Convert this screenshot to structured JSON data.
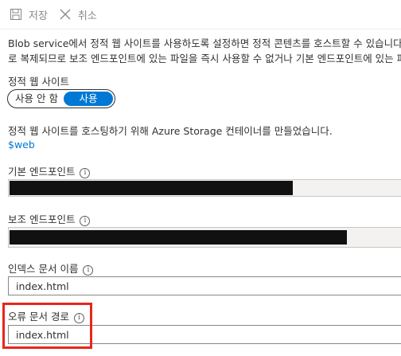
{
  "toolbar": {
    "save_label": "저장",
    "cancel_label": "취소"
  },
  "description": {
    "line1": "Blob service에서 정적 웹 사이트를 사용하도록 설정하면 정적 콘텐츠를 호스트할 수 있습니다. 웹",
    "line2": "로 복제되므로 보조 엔드포인트에 있는 파일을 즉시 사용할 수 없거나 기본 엔드포인트에 있는 파일"
  },
  "static_website": {
    "label": "정적 웹 사이트",
    "toggle": {
      "off_label": "사용 안 함",
      "on_label": "사용",
      "selected": "사용"
    }
  },
  "container": {
    "message": "정적 웹 사이트를 호스팅하기 위해 Azure Storage 컨테이너를 만들었습니다.",
    "link": "$web"
  },
  "primary_endpoint": {
    "label": "기본 엔드포인트",
    "info_icon": "i",
    "value": ""
  },
  "secondary_endpoint": {
    "label": "보조 엔드포인트",
    "info_icon": "i",
    "value": ""
  },
  "index_document": {
    "label": "인덱스 문서 이름",
    "info_icon": "i",
    "value": "index.html"
  },
  "error_document": {
    "label": "오류 문서 경로",
    "info_icon": "i",
    "value": "index.html"
  },
  "colors": {
    "accent": "#0078d4",
    "highlight": "#e8261a",
    "redaction": "#111111"
  }
}
